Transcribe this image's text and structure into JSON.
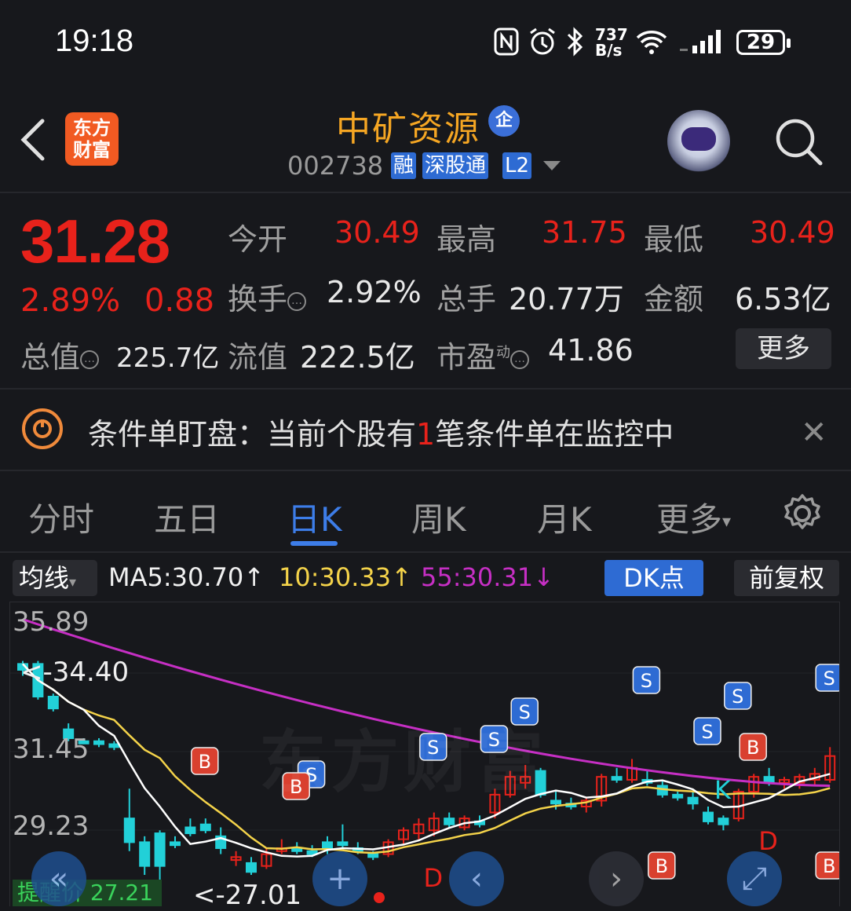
{
  "status_bar": {
    "time": "19:18",
    "net_speed_top": "737",
    "net_speed_bottom": "B/s",
    "battery": "29",
    "icons": [
      "nfc-icon",
      "alarm-icon",
      "bluetooth-icon",
      "wifi-icon",
      "signal-icon",
      "battery-icon"
    ]
  },
  "header": {
    "back_icon": "chevron-left-icon",
    "logo_text": "东方\n财富",
    "stock_name": "中矿资源",
    "enterprise_badge": "企",
    "stock_code": "002738",
    "tags": [
      "融",
      "深股通",
      "L2"
    ],
    "search_icon": "search-icon"
  },
  "quote": {
    "price": "31.28",
    "change_pct": "2.89%",
    "change_amt": "0.88",
    "open_label": "今开",
    "open_value": "30.49",
    "high_label": "最高",
    "high_value": "31.75",
    "low_label": "最低",
    "low_value": "30.49",
    "turnover_label": "换手",
    "turnover_value": "2.92%",
    "volume_label": "总手",
    "volume_value": "20.77万",
    "amount_label": "金额",
    "amount_value": "6.53亿",
    "mktcap_label": "总值",
    "mktcap_value": "225.7亿",
    "float_label": "流值",
    "float_value": "222.5亿",
    "pe_label": "市盈",
    "pe_super": "动",
    "pe_value": "41.86",
    "more_label": "更多"
  },
  "condition_banner": {
    "prefix": "条件单盯盘：当前个股有",
    "count": "1",
    "suffix": "笔条件单在监控中"
  },
  "tabs": [
    "分时",
    "五日",
    "日K",
    "周K",
    "月K",
    "更多"
  ],
  "active_tab": "日K",
  "indicators": {
    "select_label": "均线",
    "ma5": "MA5:30.70↑",
    "ma10": "10:30.33↑",
    "ma55": "55:30.31↓",
    "dk_label": "DK点",
    "adjust_label": "前复权"
  },
  "chart_data": {
    "type": "candlestick",
    "y_ticks": [
      "35.89",
      "31.45",
      "29.23"
    ],
    "max_label": "<-34.40",
    "min_label": "<-27.01",
    "remind_label": "提醒价 27.21",
    "watermark": "东方财富",
    "colors": {
      "up": "#e8221b",
      "down": "#22d0d8",
      "ma5": "#ffffff",
      "ma10": "#f4d34a",
      "ma55": "#c62fc4"
    },
    "signals": [
      "S",
      "B",
      "K",
      "D"
    ]
  }
}
